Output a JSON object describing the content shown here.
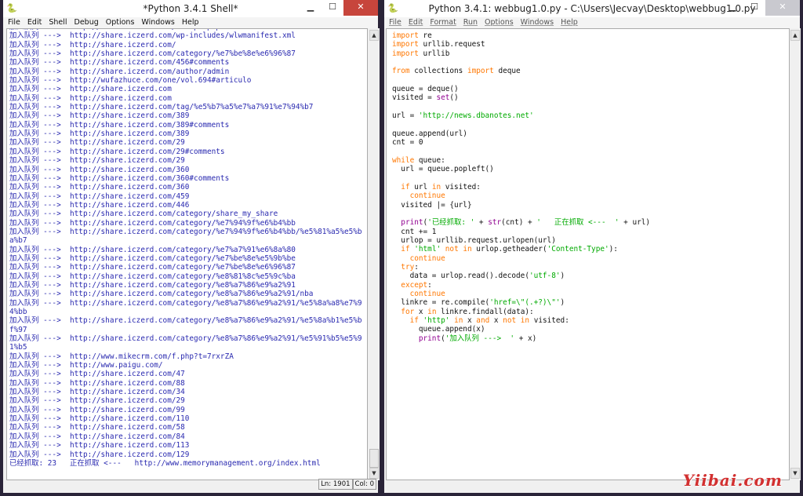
{
  "shell": {
    "title": "*Python 3.4.1 Shell*",
    "menu": [
      "File",
      "Edit",
      "Shell",
      "Debug",
      "Options",
      "Windows",
      "Help"
    ],
    "lines": [
      {
        "p": "加入队列 --->  ",
        "u": "http://share.iczerd.com/xmlrpc.php?rsd"
      },
      {
        "p": "加入队列 --->  ",
        "u": "http://share.iczerd.com/wp-includes/wlwmanifest.xml"
      },
      {
        "p": "加入队列 --->  ",
        "u": "http://share.iczerd.com/"
      },
      {
        "p": "加入队列 --->  ",
        "u": "http://share.iczerd.com/category/%e7%be%8e%e6%96%87"
      },
      {
        "p": "加入队列 --->  ",
        "u": "http://share.iczerd.com/456#comments"
      },
      {
        "p": "加入队列 --->  ",
        "u": "http://share.iczerd.com/author/admin"
      },
      {
        "p": "加入队列 --->  ",
        "u": "http://wufazhuce.com/one/vol.694#articulo"
      },
      {
        "p": "加入队列 --->  ",
        "u": "http://share.iczerd.com"
      },
      {
        "p": "加入队列 --->  ",
        "u": "http://share.iczerd.com"
      },
      {
        "p": "加入队列 --->  ",
        "u": "http://share.iczerd.com/tag/%e5%b7%a5%e7%a7%91%e7%94%b7"
      },
      {
        "p": "加入队列 --->  ",
        "u": "http://share.iczerd.com/389"
      },
      {
        "p": "加入队列 --->  ",
        "u": "http://share.iczerd.com/389#comments"
      },
      {
        "p": "加入队列 --->  ",
        "u": "http://share.iczerd.com/389"
      },
      {
        "p": "加入队列 --->  ",
        "u": "http://share.iczerd.com/29"
      },
      {
        "p": "加入队列 --->  ",
        "u": "http://share.iczerd.com/29#comments"
      },
      {
        "p": "加入队列 --->  ",
        "u": "http://share.iczerd.com/29"
      },
      {
        "p": "加入队列 --->  ",
        "u": "http://share.iczerd.com/360"
      },
      {
        "p": "加入队列 --->  ",
        "u": "http://share.iczerd.com/360#comments"
      },
      {
        "p": "加入队列 --->  ",
        "u": "http://share.iczerd.com/360"
      },
      {
        "p": "加入队列 --->  ",
        "u": "http://share.iczerd.com/459"
      },
      {
        "p": "加入队列 --->  ",
        "u": "http://share.iczerd.com/446"
      },
      {
        "p": "加入队列 --->  ",
        "u": "http://share.iczerd.com/category/share_my_share"
      },
      {
        "p": "加入队列 --->  ",
        "u": "http://share.iczerd.com/category/%e7%94%9f%e6%b4%bb"
      },
      {
        "p": "加入队列 --->  ",
        "u": "http://share.iczerd.com/category/%e7%94%9f%e6%b4%bb/%e5%81%a5%e5%b"
      },
      {
        "p": "",
        "u": "a%b7"
      },
      {
        "p": "加入队列 --->  ",
        "u": "http://share.iczerd.com/category/%e7%a7%91%e6%8a%80"
      },
      {
        "p": "加入队列 --->  ",
        "u": "http://share.iczerd.com/category/%e7%be%8e%e5%9b%be"
      },
      {
        "p": "加入队列 --->  ",
        "u": "http://share.iczerd.com/category/%e7%be%8e%e6%96%87"
      },
      {
        "p": "加入队列 --->  ",
        "u": "http://share.iczerd.com/category/%e8%81%8c%e5%9c%ba"
      },
      {
        "p": "加入队列 --->  ",
        "u": "http://share.iczerd.com/category/%e8%a7%86%e9%a2%91"
      },
      {
        "p": "加入队列 --->  ",
        "u": "http://share.iczerd.com/category/%e8%a7%86%e9%a2%91/nba"
      },
      {
        "p": "加入队列 --->  ",
        "u": "http://share.iczerd.com/category/%e8%a7%86%e9%a2%91/%e5%8a%a8%e7%9"
      },
      {
        "p": "",
        "u": "4%bb"
      },
      {
        "p": "加入队列 --->  ",
        "u": "http://share.iczerd.com/category/%e8%a7%86%e9%a2%91/%e5%8a%b1%e5%b"
      },
      {
        "p": "",
        "u": "f%97"
      },
      {
        "p": "加入队列 --->  ",
        "u": "http://share.iczerd.com/category/%e8%a7%86%e9%a2%91/%e5%91%b5%e5%9"
      },
      {
        "p": "",
        "u": "1%b5"
      },
      {
        "p": "加入队列 --->  ",
        "u": "http://www.mikecrm.com/f.php?t=7rxrZA"
      },
      {
        "p": "加入队列 --->  ",
        "u": "http://www.paigu.com/"
      },
      {
        "p": "加入队列 --->  ",
        "u": "http://share.iczerd.com/47"
      },
      {
        "p": "加入队列 --->  ",
        "u": "http://share.iczerd.com/88"
      },
      {
        "p": "加入队列 --->  ",
        "u": "http://share.iczerd.com/34"
      },
      {
        "p": "加入队列 --->  ",
        "u": "http://share.iczerd.com/29"
      },
      {
        "p": "加入队列 --->  ",
        "u": "http://share.iczerd.com/99"
      },
      {
        "p": "加入队列 --->  ",
        "u": "http://share.iczerd.com/110"
      },
      {
        "p": "加入队列 --->  ",
        "u": "http://share.iczerd.com/58"
      },
      {
        "p": "加入队列 --->  ",
        "u": "http://share.iczerd.com/84"
      },
      {
        "p": "加入队列 --->  ",
        "u": "http://share.iczerd.com/113"
      },
      {
        "p": "加入队列 --->  ",
        "u": "http://share.iczerd.com/129"
      },
      {
        "p": "已经抓取: 23   正在抓取 <---   ",
        "u": "http://www.memorymanagement.org/index.html"
      }
    ],
    "status": {
      "ln": "Ln: 1901",
      "col": "Col: 0"
    }
  },
  "editor": {
    "title": "Python 3.4.1: webbug1.0.py - C:\\Users\\Jecvay\\Desktop\\webbug1.0.py",
    "menu": [
      "File",
      "Edit",
      "Format",
      "Run",
      "Options",
      "Windows",
      "Help"
    ],
    "code": [
      [
        [
          "kw",
          "import"
        ],
        [
          "t",
          " re"
        ]
      ],
      [
        [
          "kw",
          "import"
        ],
        [
          "t",
          " urllib.request"
        ]
      ],
      [
        [
          "kw",
          "import"
        ],
        [
          "t",
          " urllib"
        ]
      ],
      [],
      [
        [
          "kw",
          "from"
        ],
        [
          "t",
          " collections "
        ],
        [
          "kw",
          "import"
        ],
        [
          "t",
          " deque"
        ]
      ],
      [],
      [
        [
          "t",
          "queue = deque()"
        ]
      ],
      [
        [
          "t",
          "visited = "
        ],
        [
          "bi",
          "set"
        ],
        [
          "t",
          "()"
        ]
      ],
      [],
      [
        [
          "t",
          "url = "
        ],
        [
          "str",
          "'http://news.dbanotes.net'"
        ]
      ],
      [],
      [
        [
          "t",
          "queue.append(url)"
        ]
      ],
      [
        [
          "t",
          "cnt = 0"
        ]
      ],
      [],
      [
        [
          "kw",
          "while"
        ],
        [
          "t",
          " queue:"
        ]
      ],
      [
        [
          "t",
          "  url = queue.popleft()"
        ]
      ],
      [],
      [
        [
          "t",
          "  "
        ],
        [
          "kw",
          "if"
        ],
        [
          "t",
          " url "
        ],
        [
          "kw",
          "in"
        ],
        [
          "t",
          " visited:"
        ]
      ],
      [
        [
          "t",
          "    "
        ],
        [
          "kw",
          "continue"
        ]
      ],
      [
        [
          "t",
          "  visited |= {url}"
        ]
      ],
      [],
      [
        [
          "t",
          "  "
        ],
        [
          "bi",
          "print"
        ],
        [
          "t",
          "("
        ],
        [
          "str",
          "'已经抓取: '"
        ],
        [
          "t",
          " + "
        ],
        [
          "bi",
          "str"
        ],
        [
          "t",
          "(cnt) + "
        ],
        [
          "str",
          "'   正在抓取 <---  '"
        ],
        [
          "t",
          " + url)"
        ]
      ],
      [
        [
          "t",
          "  cnt += 1"
        ]
      ],
      [
        [
          "t",
          "  urlop = urllib.request.urlopen(url)"
        ]
      ],
      [
        [
          "t",
          "  "
        ],
        [
          "kw",
          "if"
        ],
        [
          "t",
          " "
        ],
        [
          "str",
          "'html'"
        ],
        [
          "t",
          " "
        ],
        [
          "kw",
          "not in"
        ],
        [
          "t",
          " urlop.getheader("
        ],
        [
          "str",
          "'Content-Type'"
        ],
        [
          "t",
          "):"
        ]
      ],
      [
        [
          "t",
          "    "
        ],
        [
          "kw",
          "continue"
        ]
      ],
      [
        [
          "t",
          "  "
        ],
        [
          "kw",
          "try"
        ],
        [
          "t",
          ":"
        ]
      ],
      [
        [
          "t",
          "    data = urlop.read().decode("
        ],
        [
          "str",
          "'utf-8'"
        ],
        [
          "t",
          ")"
        ]
      ],
      [
        [
          "t",
          "  "
        ],
        [
          "kw",
          "except"
        ],
        [
          "t",
          ":"
        ]
      ],
      [
        [
          "t",
          "    "
        ],
        [
          "kw",
          "continue"
        ]
      ],
      [
        [
          "t",
          "  linkre = re.compile("
        ],
        [
          "str",
          "'href=\\\"(.+?)\\\"'"
        ],
        [
          "t",
          ")"
        ]
      ],
      [
        [
          "t",
          "  "
        ],
        [
          "kw",
          "for"
        ],
        [
          "t",
          " x "
        ],
        [
          "kw",
          "in"
        ],
        [
          "t",
          " linkre.findall(data):"
        ]
      ],
      [
        [
          "t",
          "    "
        ],
        [
          "kw",
          "if"
        ],
        [
          "t",
          " "
        ],
        [
          "str",
          "'http'"
        ],
        [
          "t",
          " "
        ],
        [
          "kw",
          "in"
        ],
        [
          "t",
          " x "
        ],
        [
          "kw",
          "and"
        ],
        [
          "t",
          " x "
        ],
        [
          "kw",
          "not in"
        ],
        [
          "t",
          " visited:"
        ]
      ],
      [
        [
          "t",
          "      queue.append(x)"
        ]
      ],
      [
        [
          "t",
          "      "
        ],
        [
          "bi",
          "print"
        ],
        [
          "t",
          "("
        ],
        [
          "str",
          "'加入队列 --->  '"
        ],
        [
          "t",
          " + x)"
        ]
      ]
    ]
  },
  "watermark": "Yiibai.com",
  "colors": {
    "frame": "#2a2438",
    "close": "#c7453c",
    "keyword": "#ff7700",
    "string": "#00aa00",
    "builtin": "#900090",
    "output": "#2a2ab0"
  }
}
